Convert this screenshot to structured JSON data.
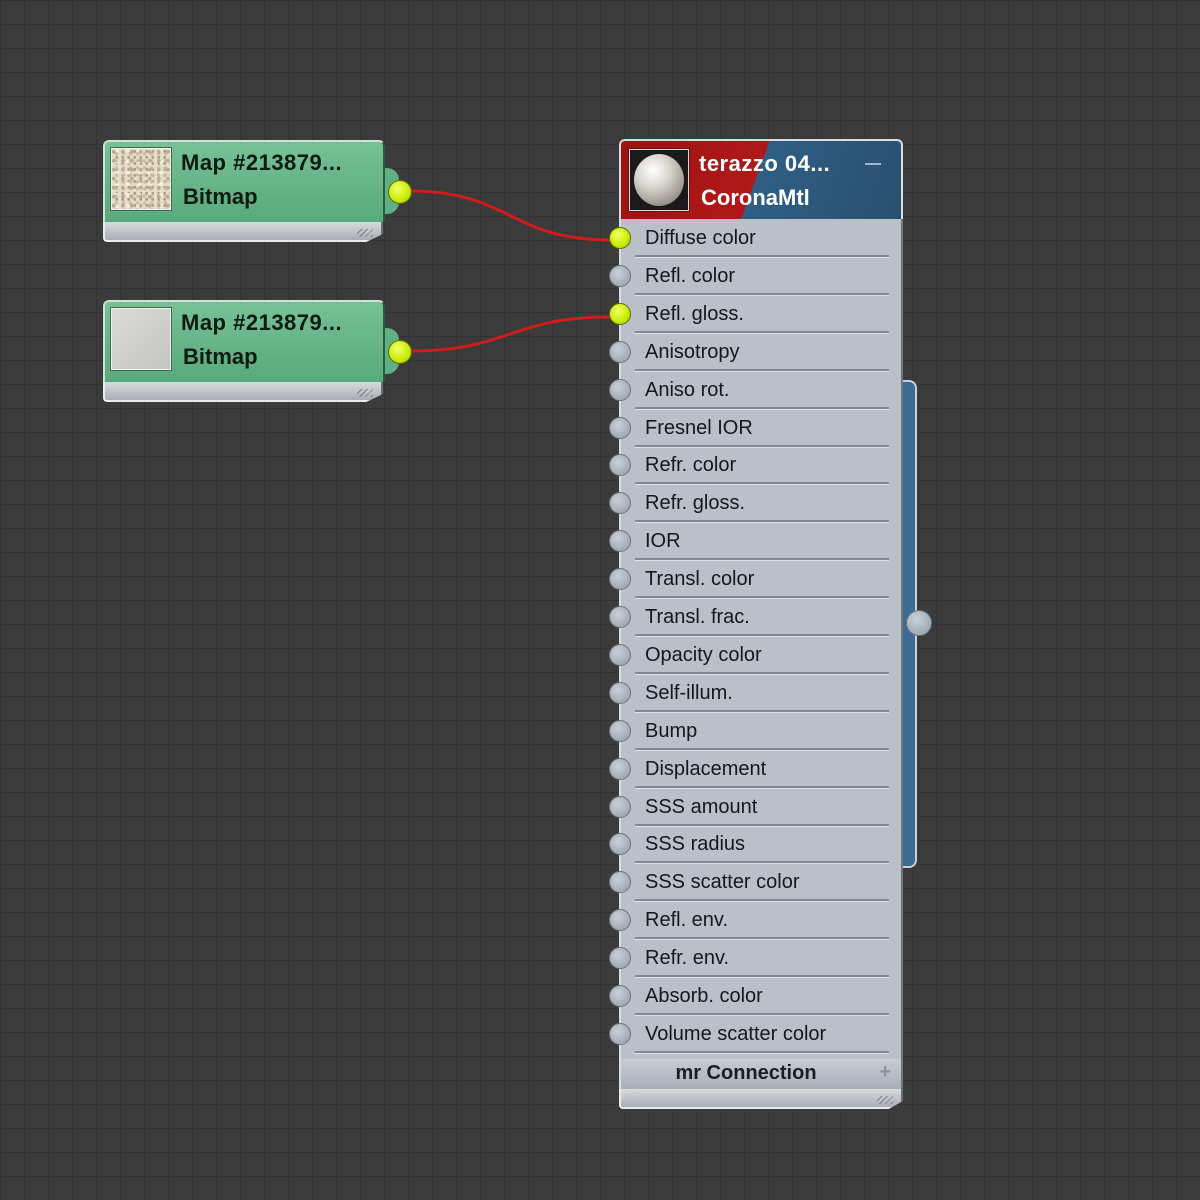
{
  "map_nodes": [
    {
      "title": "Map #213879...",
      "type": "Bitmap",
      "swatch": "terrazzo-texture"
    },
    {
      "title": "Map #213879...",
      "type": "Bitmap",
      "swatch": "grey-gloss-texture"
    }
  ],
  "material": {
    "title": "terazzo 04...",
    "type": "CoronaMtl",
    "slots": [
      {
        "label": "Diffuse color",
        "connected": true
      },
      {
        "label": "Refl. color",
        "connected": false
      },
      {
        "label": "Refl. gloss.",
        "connected": true
      },
      {
        "label": "Anisotropy",
        "connected": false
      },
      {
        "label": "Aniso rot.",
        "connected": false
      },
      {
        "label": "Fresnel IOR",
        "connected": false
      },
      {
        "label": "Refr. color",
        "connected": false
      },
      {
        "label": "Refr. gloss.",
        "connected": false
      },
      {
        "label": "IOR",
        "connected": false
      },
      {
        "label": "Transl. color",
        "connected": false
      },
      {
        "label": "Transl. frac.",
        "connected": false
      },
      {
        "label": "Opacity color",
        "connected": false
      },
      {
        "label": "Self-illum.",
        "connected": false
      },
      {
        "label": "Bump",
        "connected": false
      },
      {
        "label": "Displacement",
        "connected": false
      },
      {
        "label": "SSS amount",
        "connected": false
      },
      {
        "label": "SSS radius",
        "connected": false
      },
      {
        "label": "SSS scatter color",
        "connected": false
      },
      {
        "label": "Refl. env.",
        "connected": false
      },
      {
        "label": "Refr. env.",
        "connected": false
      },
      {
        "label": "Absorb. color",
        "connected": false
      },
      {
        "label": "Volume scatter color",
        "connected": false
      }
    ],
    "footer": {
      "label": "mr Connection",
      "expand_icon": "plus-icon"
    }
  },
  "wires": [
    {
      "from": "map_nodes.0",
      "to": "Diffuse color",
      "color": "#d01c1c"
    },
    {
      "from": "map_nodes.1",
      "to": "Refl. gloss.",
      "color": "#d01c1c"
    }
  ],
  "colors": {
    "map_node": "#5fb083",
    "material_header_red": "#b11818",
    "material_header_blue": "#2f5f85",
    "connected_port": "#c5ec00",
    "canvas": "#3b3b3b"
  }
}
